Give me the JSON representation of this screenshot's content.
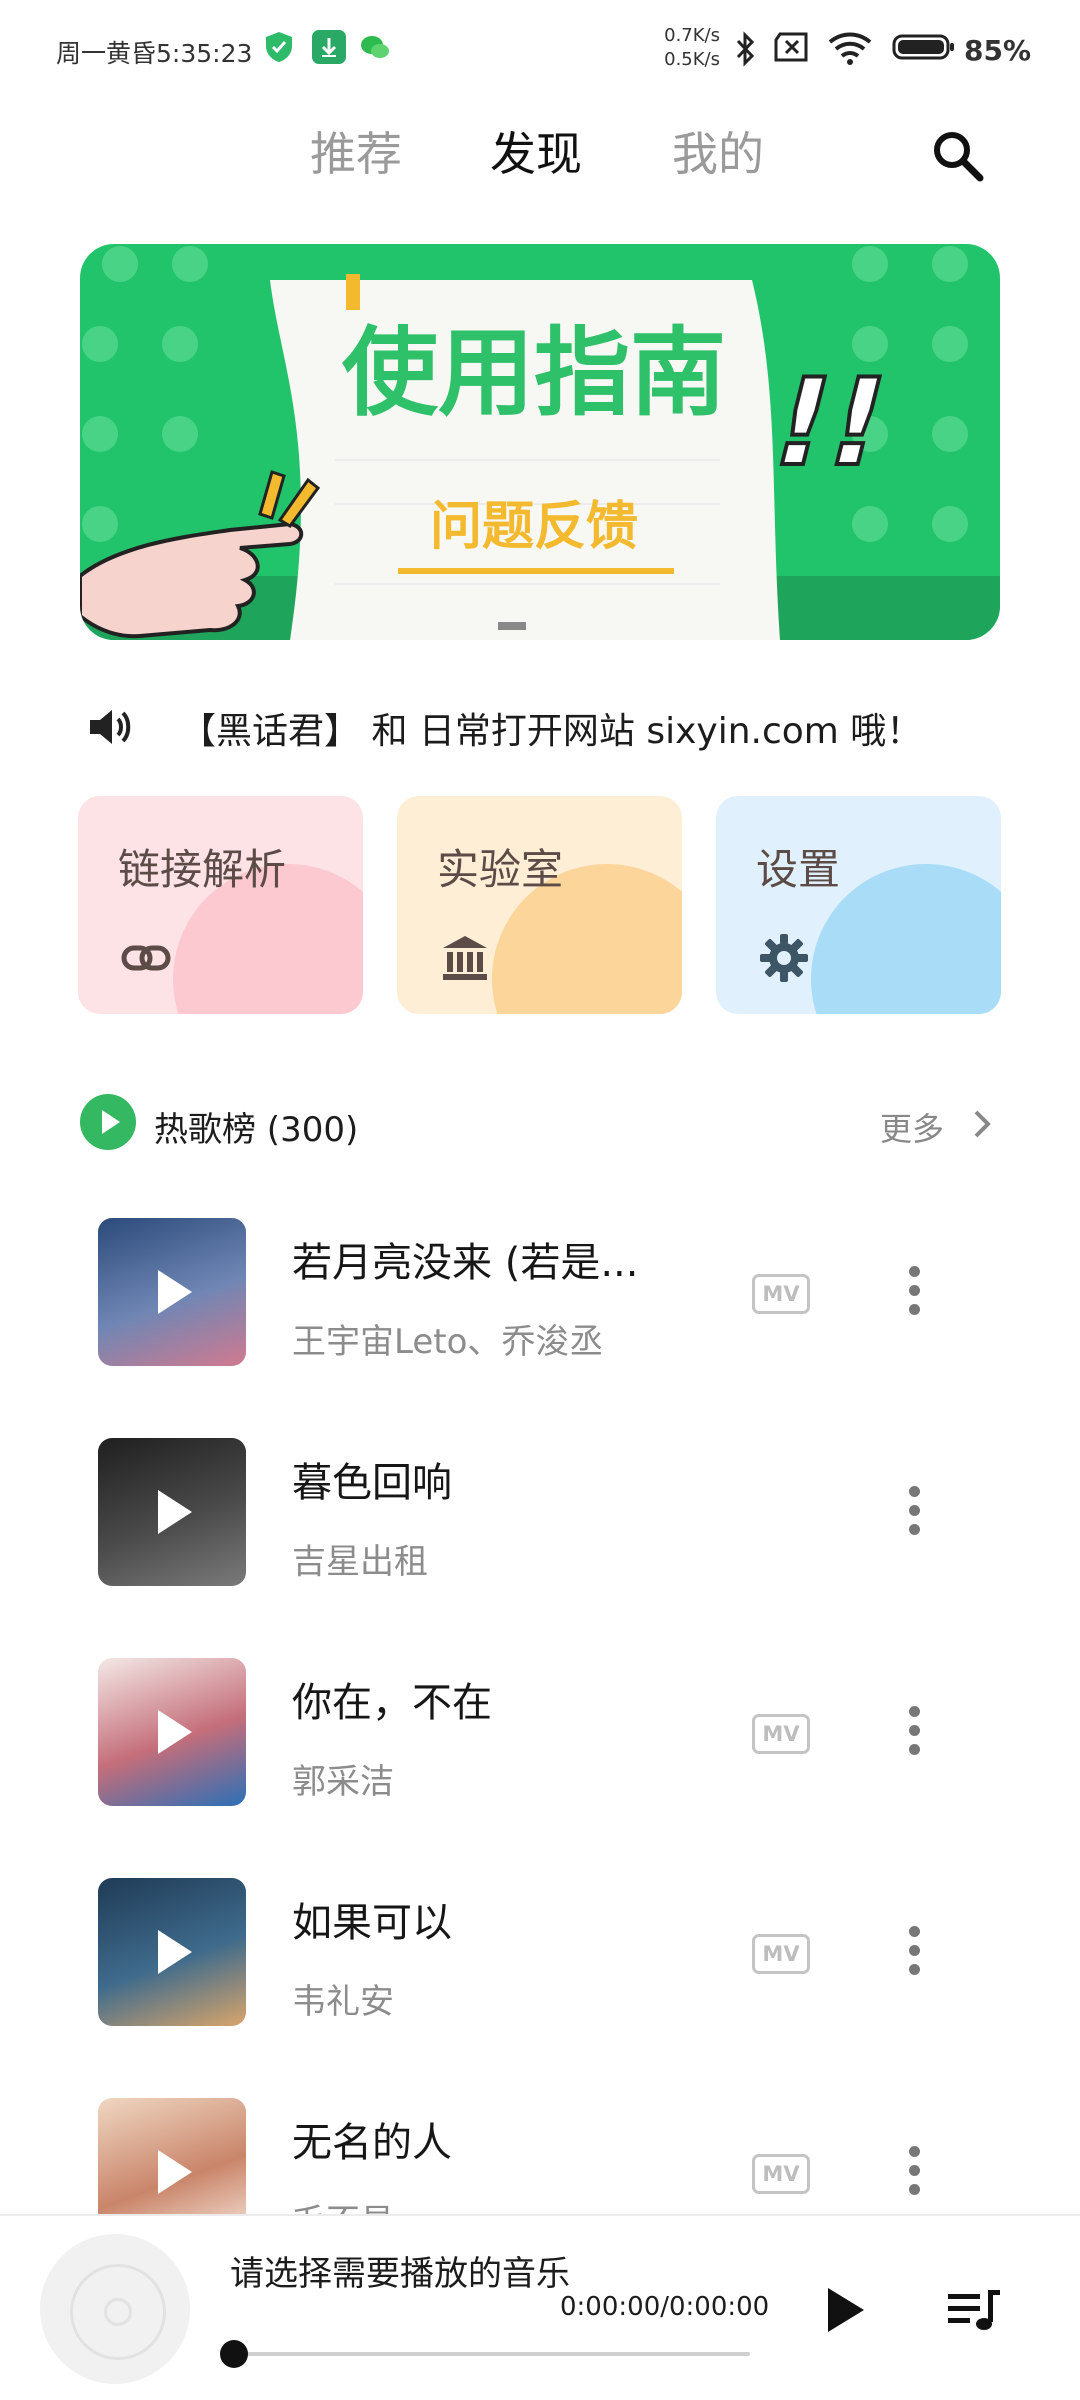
{
  "status_bar": {
    "time": "周一黄昏5:35:23",
    "net_up": "0.7K/s",
    "net_down": "0.5K/s",
    "battery": "85%",
    "icons": [
      "shield-check-icon",
      "download-icon",
      "wechat-icon",
      "bluetooth-icon",
      "no-sim-icon",
      "wifi-icon",
      "battery-icon"
    ]
  },
  "nav": {
    "tabs": [
      {
        "label": "推荐",
        "active": false
      },
      {
        "label": "发现",
        "active": true
      },
      {
        "label": "我的",
        "active": false
      }
    ],
    "search_icon": "search-icon"
  },
  "banner": {
    "title": "使用指南",
    "subtitle": "问题反馈",
    "exclaim": "!!",
    "colors": {
      "green": "#22c46b",
      "yellow": "#f3b92f"
    }
  },
  "notice": {
    "icon": "speaker-icon",
    "text": "【黑话君】 和 日常打开网站 sixyin.com 哦！"
  },
  "quick_cards": [
    {
      "label": "链接解析",
      "icon": "link-icon",
      "bg": "#fde3e6",
      "deco": "#fbc9cf"
    },
    {
      "label": "实验室",
      "icon": "bank-icon",
      "bg": "#fdeed5",
      "deco": "#fcd59b"
    },
    {
      "label": "设置",
      "icon": "gear-icon",
      "bg": "#e0f1fd",
      "deco": "#a9dcf7"
    }
  ],
  "hot_chart": {
    "title": "热歌榜 (300)",
    "more": "更多"
  },
  "songs": [
    {
      "title": "若月亮没来 (若是...",
      "artist": "王宇宙Leto、乔浚丞",
      "mv": true,
      "cover": [
        "#2b4a7a",
        "#6f86b4",
        "#d17a8f"
      ]
    },
    {
      "title": "暮色回响",
      "artist": "吉星出租",
      "mv": false,
      "cover": [
        "#1f1f1f",
        "#4a4a4a",
        "#7a7a7a"
      ]
    },
    {
      "title": "你在，不在",
      "artist": "郭采洁",
      "mv": true,
      "cover": [
        "#f4e9e6",
        "#c46e7a",
        "#2c6fb7"
      ]
    },
    {
      "title": "如果可以",
      "artist": "韦礼安",
      "mv": true,
      "cover": [
        "#1f3b56",
        "#3f6b8c",
        "#d9a56b"
      ]
    },
    {
      "title": "无名的人",
      "artist": "毛不易",
      "mv": true,
      "cover": [
        "#f0d7c2",
        "#c9856a",
        "#fbeee4"
      ]
    }
  ],
  "mv_label": "MV",
  "player": {
    "title": "请选择需要播放的音乐",
    "time": "0:00:00/0:00:00",
    "progress": 0
  }
}
